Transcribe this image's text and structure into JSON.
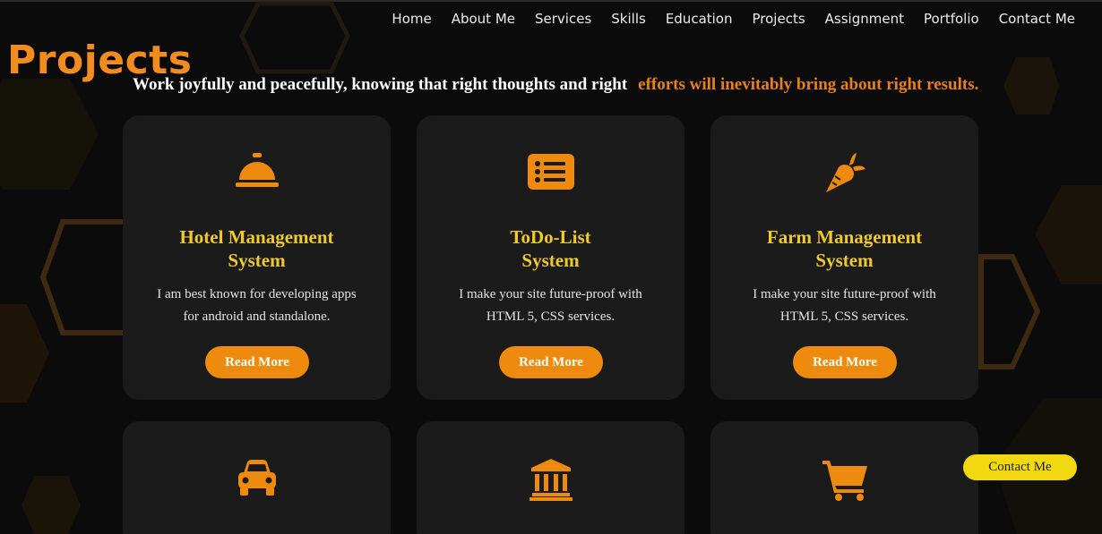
{
  "nav": {
    "items": [
      {
        "label": "Home"
      },
      {
        "label": "About Me"
      },
      {
        "label": "Services"
      },
      {
        "label": "Skills"
      },
      {
        "label": "Education"
      },
      {
        "label": "Projects"
      },
      {
        "label": "Assignment"
      },
      {
        "label": "Portfolio"
      },
      {
        "label": "Contact Me"
      }
    ]
  },
  "page": {
    "title": "Projects",
    "tagline_white": "Work joyfully and peacefully, knowing that right thoughts and right",
    "tagline_orange": "efforts will inevitably bring about right results."
  },
  "projects": [
    {
      "icon": "concierge-bell-icon",
      "title_line1": "Hotel Management",
      "title_line2": "System",
      "desc_line1": "I am best known for developing apps",
      "desc_line2": "for android and standalone.",
      "button": "Read More"
    },
    {
      "icon": "list-icon",
      "title_line1": "ToDo-List",
      "title_line2": "System",
      "desc_line1": "I make your site future-proof with",
      "desc_line2": "HTML 5, CSS services.",
      "button": "Read More"
    },
    {
      "icon": "carrot-icon",
      "title_line1": "Farm Management",
      "title_line2": "System",
      "desc_line1": "I make your site future-proof with",
      "desc_line2": "HTML 5, CSS services.",
      "button": "Read More"
    },
    {
      "icon": "car-icon"
    },
    {
      "icon": "bank-icon"
    },
    {
      "icon": "shopping-cart-icon"
    }
  ],
  "floating_contact": {
    "label": "Contact Me"
  },
  "colors": {
    "accent_orange": "#f28c1f",
    "title_yellow": "#f0c92a",
    "button_orange": "#ee8a0d",
    "card_bg": "#1b1b1b",
    "page_bg": "#0b0b0b",
    "contact_yellow": "#f2d80f"
  }
}
